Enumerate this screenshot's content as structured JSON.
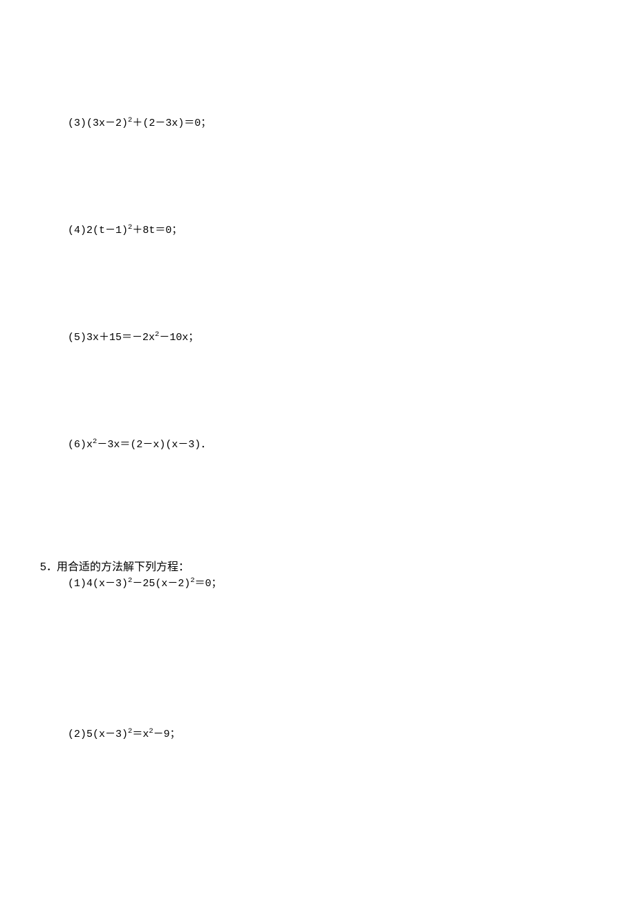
{
  "equations": {
    "eq3": "(3)(3x－2)²＋(2－3x)＝0；",
    "eq4": "(4)2(t－1)²＋8t＝0；",
    "eq5": "(5)3x＋15＝－2x²－10x；",
    "eq6": "(6)x²－3x＝(2－x)(x－3)．"
  },
  "question5": {
    "number": "5．",
    "text": "用合适的方法解下列方程：",
    "sub1": "(1)4(x－3)²－25(x－2)²＝0；",
    "sub2": "(2)5(x－3)²＝x²－9；"
  }
}
